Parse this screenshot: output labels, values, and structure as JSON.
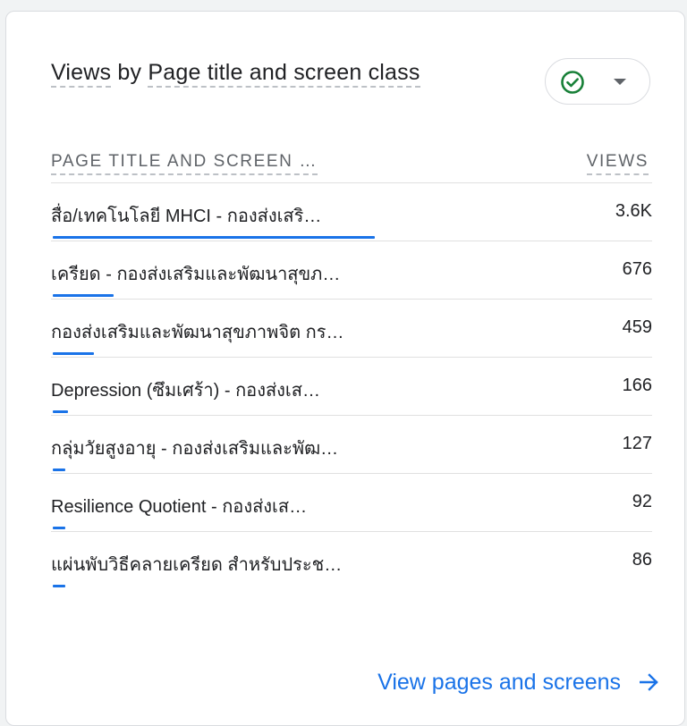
{
  "card": {
    "title_part1": "Views",
    "title_part2": " by ",
    "title_part3": "Page title and screen class",
    "status_icon": "check-circle-icon",
    "dropdown_icon": "caret-down-icon"
  },
  "table": {
    "col_left": "PAGE TITLE AND SCREEN …",
    "col_right": "VIEWS",
    "rows": [
      {
        "label": "สื่อ/เทคโนโลยี MHCI - กองส่งเสริ…",
        "value": "3.6K",
        "ratio": 1.0
      },
      {
        "label": "เครียด - กองส่งเสริมและพัฒนาสุขภ…",
        "value": "676",
        "ratio": 0.188
      },
      {
        "label": "กองส่งเสริมและพัฒนาสุขภาพจิต กร…",
        "value": "459",
        "ratio": 0.128
      },
      {
        "label": "Depression (ซึมเศร้า) - กองส่งเส…",
        "value": "166",
        "ratio": 0.046
      },
      {
        "label": "กลุ่มวัยสูงอายุ - กองส่งเสริมและพัฒ…",
        "value": "127",
        "ratio": 0.035
      },
      {
        "label": "Resilience Quotient - กองส่งเส…",
        "value": "92",
        "ratio": 0.026
      },
      {
        "label": "แผ่นพับวิธีคลายเครียด สำหรับประช…",
        "value": "86",
        "ratio": 0.024
      }
    ]
  },
  "footer": {
    "link_label": "View pages and screens",
    "arrow_icon": "arrow-right-icon"
  },
  "colors": {
    "accent": "#1a73e8",
    "success": "#188038",
    "text": "#202124",
    "muted": "#5f6368"
  }
}
